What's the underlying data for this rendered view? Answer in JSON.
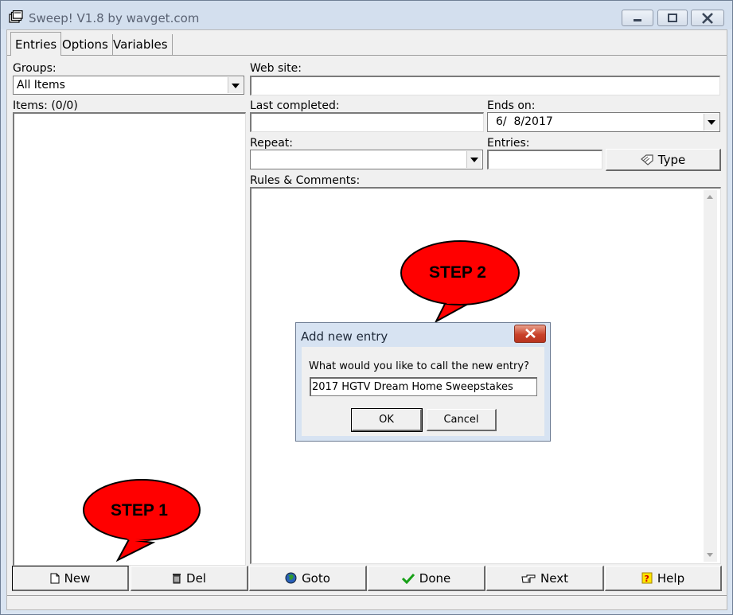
{
  "window": {
    "title": "Sweep! V1.8 by wavget.com"
  },
  "tabs": [
    "Entries",
    "Options",
    "Variables"
  ],
  "groups": {
    "label": "Groups:",
    "value": "All Items"
  },
  "items": {
    "label": "Items: (0/0)"
  },
  "website": {
    "label": "Web site:",
    "value": ""
  },
  "last_completed": {
    "label": "Last completed:",
    "value": ""
  },
  "ends_on": {
    "label": "Ends on:",
    "value": "6/  8/2017"
  },
  "repeat": {
    "label": "Repeat:",
    "value": ""
  },
  "entries": {
    "label": "Entries:",
    "value": ""
  },
  "type_button": "Type",
  "rules": {
    "label": "Rules & Comments:"
  },
  "buttons": {
    "new": "New",
    "del": "Del",
    "goto": "Goto",
    "done": "Done",
    "next": "Next",
    "help": "Help"
  },
  "callouts": {
    "step1": "STEP 1",
    "step2": "STEP 2",
    "color": "#ff0000"
  },
  "dialog": {
    "title": "Add new entry",
    "prompt": "What would you like to call the new entry?",
    "input_value": "2017 HGTV Dream Home Sweepstakes",
    "ok": "OK",
    "cancel": "Cancel"
  }
}
